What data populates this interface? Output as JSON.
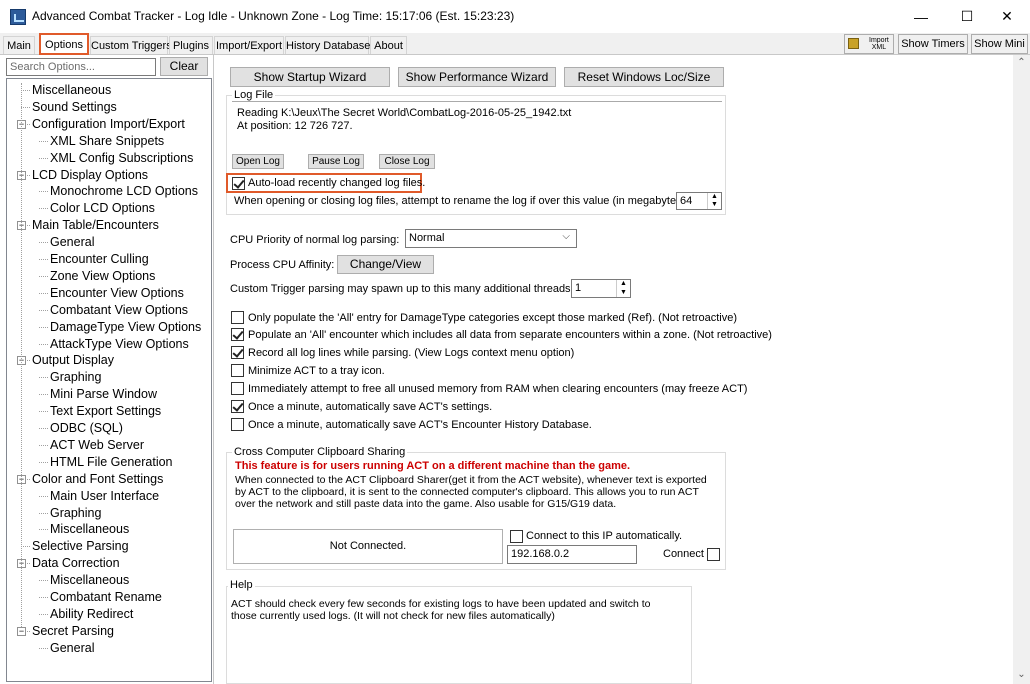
{
  "window": {
    "title": "Advanced Combat Tracker - Log Idle - Unknown Zone - Log Time: 15:17:06 (Est. 15:23:23)",
    "minimize": "—",
    "maximize": "☐",
    "close": "✕"
  },
  "tabs": [
    "Main",
    "Options",
    "Custom Triggers",
    "Plugins",
    "Import/Export",
    "History Database",
    "About"
  ],
  "toolbar": {
    "import_xml": [
      "Import",
      "XML"
    ],
    "show_timers": "Show Timers",
    "show_mini": "Show Mini"
  },
  "left": {
    "search_placeholder": "Search Options...",
    "clear": "Clear",
    "tree": [
      {
        "label": "Miscellaneous",
        "level": 0
      },
      {
        "label": "Sound Settings",
        "level": 0
      },
      {
        "label": "Configuration Import/Export",
        "level": 0,
        "expander": "⊟"
      },
      {
        "label": "XML Share Snippets",
        "level": 1
      },
      {
        "label": "XML Config Subscriptions",
        "level": 1
      },
      {
        "label": "LCD Display Options",
        "level": 0,
        "expander": "⊟"
      },
      {
        "label": "Monochrome LCD Options",
        "level": 1
      },
      {
        "label": "Color LCD Options",
        "level": 1
      },
      {
        "label": "Main Table/Encounters",
        "level": 0,
        "expander": "⊟"
      },
      {
        "label": "General",
        "level": 1
      },
      {
        "label": "Encounter Culling",
        "level": 1
      },
      {
        "label": "Zone View Options",
        "level": 1
      },
      {
        "label": "Encounter View Options",
        "level": 1
      },
      {
        "label": "Combatant View Options",
        "level": 1
      },
      {
        "label": "DamageType View Options",
        "level": 1
      },
      {
        "label": "AttackType View Options",
        "level": 1
      },
      {
        "label": "Output Display",
        "level": 0,
        "expander": "⊟"
      },
      {
        "label": "Graphing",
        "level": 1
      },
      {
        "label": "Mini Parse Window",
        "level": 1
      },
      {
        "label": "Text Export Settings",
        "level": 1
      },
      {
        "label": "ODBC (SQL)",
        "level": 1
      },
      {
        "label": "ACT Web Server",
        "level": 1
      },
      {
        "label": "HTML File Generation",
        "level": 1
      },
      {
        "label": "Color and Font Settings",
        "level": 0,
        "expander": "⊟"
      },
      {
        "label": "Main User Interface",
        "level": 1
      },
      {
        "label": "Graphing",
        "level": 1
      },
      {
        "label": "Miscellaneous",
        "level": 1
      },
      {
        "label": "Selective Parsing",
        "level": 0
      },
      {
        "label": "Data Correction",
        "level": 0,
        "expander": "⊟"
      },
      {
        "label": "Miscellaneous",
        "level": 1
      },
      {
        "label": "Combatant Rename",
        "level": 1
      },
      {
        "label": "Ability Redirect",
        "level": 1
      },
      {
        "label": "Secret Parsing",
        "level": 0,
        "expander": "⊟"
      },
      {
        "label": "General",
        "level": 1
      }
    ]
  },
  "options": {
    "show_startup_wizard": "Show Startup Wizard",
    "show_performance_wizard": "Show Performance Wizard",
    "reset_windows": "Reset Windows Loc/Size",
    "log_file": {
      "group_label": "Log File",
      "reading": "Reading K:\\Jeux\\The Secret World\\CombatLog-2016-05-25_1942.txt",
      "position": "At position: 12 726 727.",
      "open_log": "Open Log",
      "pause_log": "Pause Log",
      "close_log": "Close Log",
      "auto_load": "Auto-load recently changed log files.",
      "rename_text": "When opening or closing log files, attempt to rename the log if over this value (in megabytes):",
      "rename_value": "64"
    },
    "cpu_priority_label": "CPU Priority of normal log parsing:",
    "cpu_priority_value": "Normal",
    "affinity_label": "Process CPU Affinity:",
    "affinity_button": "Change/View",
    "threads_label": "Custom Trigger parsing may spawn up to this many additional threads:",
    "threads_value": "1",
    "checkboxes": [
      {
        "label": "Only populate the 'All' entry for DamageType categories except those marked (Ref).  (Not retroactive)",
        "checked": false
      },
      {
        "label": "Populate an 'All' encounter which includes all data from separate encounters within a zone.  (Not retroactive)",
        "checked": true
      },
      {
        "label": "Record all log lines while parsing.  (View Logs context menu option)",
        "checked": true
      },
      {
        "label": "Minimize ACT to a tray icon.",
        "checked": false
      },
      {
        "label": "Immediately attempt to free all unused memory from RAM when clearing encounters (may freeze ACT)",
        "checked": false
      },
      {
        "label": "Once a minute, automatically save ACT's settings.",
        "checked": true
      },
      {
        "label": "Once a minute, automatically save ACT's Encounter History Database.",
        "checked": false
      }
    ],
    "clipboard": {
      "group_label": "Cross Computer Clipboard Sharing",
      "warning": "This feature is for users running ACT on a different machine than the game.",
      "desc1": "When connected to the ACT Clipboard Sharer(get it from the ACT website), whenever text is exported",
      "desc2": "by ACT to the clipboard, it is sent to the connected computer's clipboard.  This allows you to run ACT",
      "desc3": "over the network and still paste data into the game.  Also usable for G15/G19 data.",
      "status": "Not Connected.",
      "auto_connect": "Connect to this IP automatically.",
      "ip": "192.168.0.2",
      "connect": "Connect"
    },
    "help": {
      "group_label": "Help",
      "line1": "ACT should check every few seconds for existing logs to have been updated and switch to",
      "line2": "those currently used logs.  (It will not check for new files automatically)"
    }
  },
  "colors": {
    "highlight": "#e05a2a",
    "warning": "#cc0000"
  }
}
